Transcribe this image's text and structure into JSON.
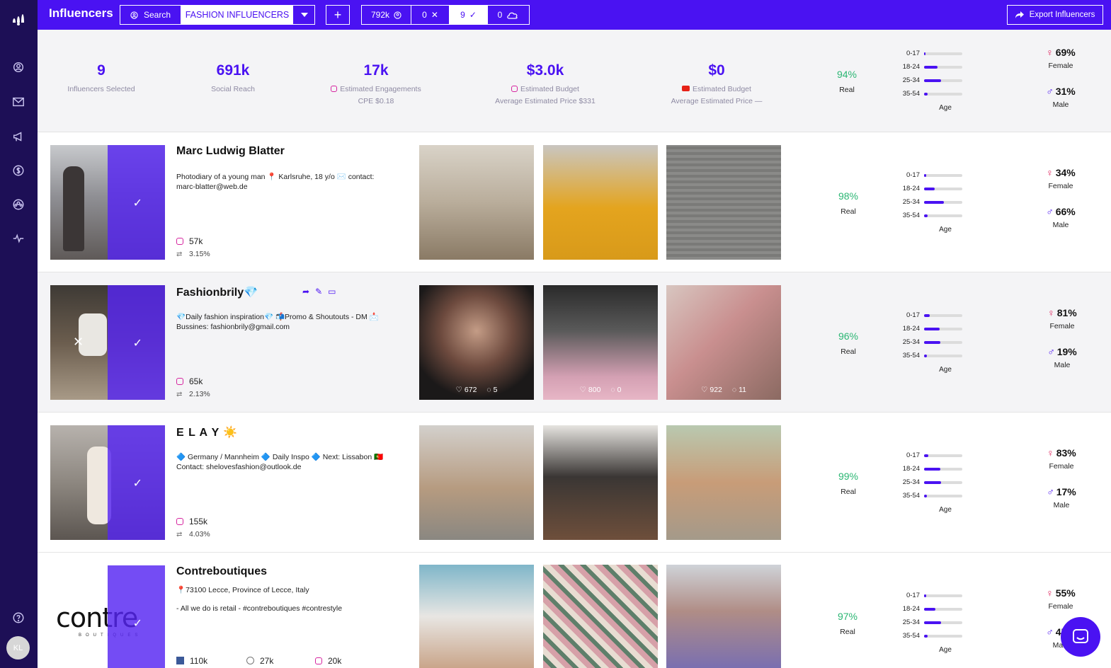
{
  "user": {
    "initials": "KL"
  },
  "header": {
    "title": "Influencers",
    "search_label": "Search",
    "list_name": "FASHION INFLUENCERS",
    "counts": {
      "total": "792k",
      "rejected": "0",
      "selected": "9",
      "cloud": "0"
    },
    "export_label": "Export Influencers"
  },
  "summary": {
    "selected": {
      "value": "9",
      "label": "Influencers Selected"
    },
    "reach": {
      "value": "691k",
      "label": "Social Reach"
    },
    "engagements": {
      "value": "17k",
      "label": "Estimated Engagements",
      "sub": "CPE $0.18"
    },
    "ig_budget": {
      "value": "$3.0k",
      "label": "Estimated Budget",
      "sub": "Average Estimated Price $331"
    },
    "yt_budget": {
      "value": "$0",
      "label": "Estimated Budget",
      "sub": "Average Estimated Price —"
    },
    "real": "94%",
    "real_label": "Real",
    "age": [
      {
        "label": "0-17",
        "value": 0.03
      },
      {
        "label": "18-24",
        "value": 0.35
      },
      {
        "label": "25-34",
        "value": 0.45
      },
      {
        "label": "35-54",
        "value": 0.1
      }
    ],
    "age_title": "Age",
    "female": "69%",
    "female_label": "Female",
    "male": "31%",
    "male_label": "Male"
  },
  "influencers": [
    {
      "name": "Marc Ludwig Blatter",
      "bio": "Photodiary of a young man 📍 Karlsruhe, 18 y/o ✉️ contact: marc-blatter@web.de",
      "followers": "57k",
      "engagement": "3.15%",
      "real": "98%",
      "age": [
        0.05,
        0.28,
        0.52,
        0.1
      ],
      "female": "34%",
      "male": "66%"
    },
    {
      "name": "Fashionbrily💎",
      "bio": "💎Daily fashion inspiration💎 📬Promo & Shoutouts - DM 📩Bussines: fashionbrily@gmail.com",
      "followers": "65k",
      "engagement": "2.13%",
      "real": "96%",
      "age": [
        0.15,
        0.4,
        0.42,
        0.07
      ],
      "female": "81%",
      "male": "19%",
      "posts": [
        {
          "likes": "672",
          "comments": "5"
        },
        {
          "likes": "800",
          "comments": "0"
        },
        {
          "likes": "922",
          "comments": "11"
        }
      ]
    },
    {
      "name": "E L A Y ☀️",
      "bio": "🔷 Germany / Mannheim 🔷 Daily Inspo 🔷 Next: Lissabon 🇵🇹 Contact: shelovesfashion@outlook.de",
      "followers": "155k",
      "engagement": "4.03%",
      "real": "99%",
      "age": [
        0.12,
        0.42,
        0.45,
        0.07
      ],
      "female": "83%",
      "male": "17%"
    },
    {
      "name": "Contreboutiques",
      "location": "73100 Lecce, Province of Lecce, Italy",
      "bio": "- All we do is retail - #contreboutiques #contrestyle",
      "fb": "110k",
      "wp": "27k",
      "ig": "20k",
      "real": "97%",
      "age": [
        0.05,
        0.3,
        0.45,
        0.1
      ],
      "female": "55%",
      "male": "45%",
      "logo_text": "contre",
      "logo_sub": "BOUTIQUES"
    }
  ]
}
